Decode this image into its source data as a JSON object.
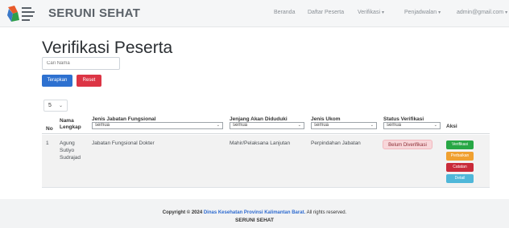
{
  "navbar": {
    "brand": "SERUNI SEHAT",
    "items": [
      {
        "label": "Beranda"
      },
      {
        "label": "Daftar Peserta"
      },
      {
        "label": "Verifikasi"
      },
      {
        "label": "Penjadwalan"
      },
      {
        "label": "admin@gmail.com"
      }
    ]
  },
  "page": {
    "title": "Verifikasi Peserta",
    "search_placeholder": "Cari Nama",
    "apply_label": "Terapkan",
    "reset_label": "Reset",
    "page_size": "5"
  },
  "table": {
    "columns": [
      {
        "label": "No"
      },
      {
        "label": "Nama Lengkap"
      },
      {
        "label": "Jenis Jabatan Fungsional",
        "filter": "semua"
      },
      {
        "label": "Jenjang Akan Diduduki",
        "filter": "semua"
      },
      {
        "label": "Jenis Ukom",
        "filter": "semua"
      },
      {
        "label": "Status Verifikasi",
        "filter": "semua"
      },
      {
        "label": "Aksi"
      }
    ],
    "rows": [
      {
        "no": "1",
        "nama": "Agung Sutiyo Sudrajad",
        "jabatan": "Jabatan Fungsional Dokter",
        "jenjang": "Mahir/Pelaksana Lanjutan",
        "ukom": "Perpindahan Jabatan",
        "status": "Belum Diverifikasi",
        "actions": [
          "Verifikasi",
          "Perbaikan",
          "Catatan",
          "Detail"
        ]
      }
    ]
  },
  "footer": {
    "copyright": "Copyright © 2024",
    "org": "Dinas Kesehatan Provinsi Kalimantan Barat.",
    "rights": "All rights reserved.",
    "brand": "SERUNI SEHAT"
  },
  "colors": {
    "primary": "#2e71d0",
    "danger": "#dc3545",
    "success": "#28a745",
    "warning": "#f0a030",
    "info": "#4fb7d9",
    "badge_bg": "#f8d7da"
  }
}
